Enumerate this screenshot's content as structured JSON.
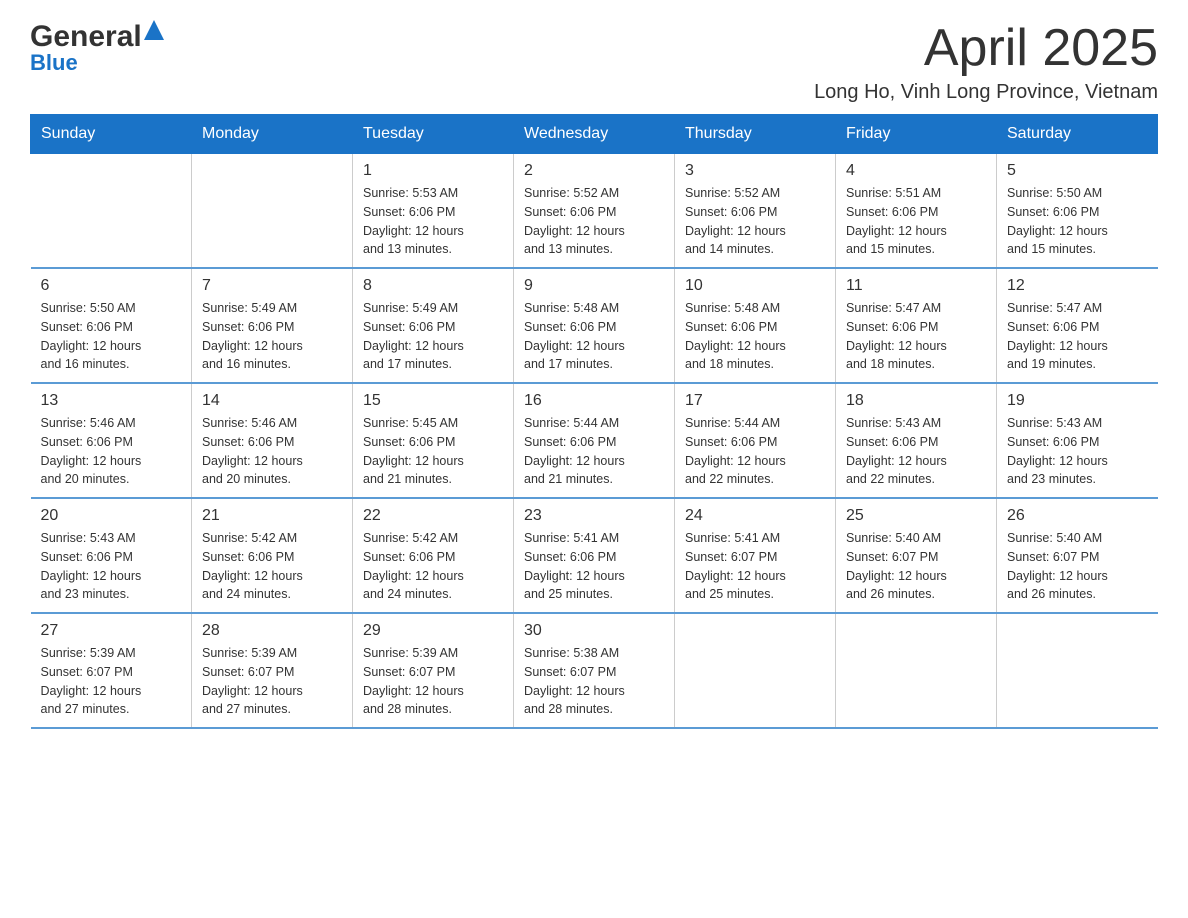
{
  "header": {
    "logo_general": "General",
    "logo_blue": "Blue",
    "title": "April 2025",
    "location": "Long Ho, Vinh Long Province, Vietnam"
  },
  "calendar": {
    "days_of_week": [
      "Sunday",
      "Monday",
      "Tuesday",
      "Wednesday",
      "Thursday",
      "Friday",
      "Saturday"
    ],
    "weeks": [
      [
        {
          "day": "",
          "info": ""
        },
        {
          "day": "",
          "info": ""
        },
        {
          "day": "1",
          "info": "Sunrise: 5:53 AM\nSunset: 6:06 PM\nDaylight: 12 hours\nand 13 minutes."
        },
        {
          "day": "2",
          "info": "Sunrise: 5:52 AM\nSunset: 6:06 PM\nDaylight: 12 hours\nand 13 minutes."
        },
        {
          "day": "3",
          "info": "Sunrise: 5:52 AM\nSunset: 6:06 PM\nDaylight: 12 hours\nand 14 minutes."
        },
        {
          "day": "4",
          "info": "Sunrise: 5:51 AM\nSunset: 6:06 PM\nDaylight: 12 hours\nand 15 minutes."
        },
        {
          "day": "5",
          "info": "Sunrise: 5:50 AM\nSunset: 6:06 PM\nDaylight: 12 hours\nand 15 minutes."
        }
      ],
      [
        {
          "day": "6",
          "info": "Sunrise: 5:50 AM\nSunset: 6:06 PM\nDaylight: 12 hours\nand 16 minutes."
        },
        {
          "day": "7",
          "info": "Sunrise: 5:49 AM\nSunset: 6:06 PM\nDaylight: 12 hours\nand 16 minutes."
        },
        {
          "day": "8",
          "info": "Sunrise: 5:49 AM\nSunset: 6:06 PM\nDaylight: 12 hours\nand 17 minutes."
        },
        {
          "day": "9",
          "info": "Sunrise: 5:48 AM\nSunset: 6:06 PM\nDaylight: 12 hours\nand 17 minutes."
        },
        {
          "day": "10",
          "info": "Sunrise: 5:48 AM\nSunset: 6:06 PM\nDaylight: 12 hours\nand 18 minutes."
        },
        {
          "day": "11",
          "info": "Sunrise: 5:47 AM\nSunset: 6:06 PM\nDaylight: 12 hours\nand 18 minutes."
        },
        {
          "day": "12",
          "info": "Sunrise: 5:47 AM\nSunset: 6:06 PM\nDaylight: 12 hours\nand 19 minutes."
        }
      ],
      [
        {
          "day": "13",
          "info": "Sunrise: 5:46 AM\nSunset: 6:06 PM\nDaylight: 12 hours\nand 20 minutes."
        },
        {
          "day": "14",
          "info": "Sunrise: 5:46 AM\nSunset: 6:06 PM\nDaylight: 12 hours\nand 20 minutes."
        },
        {
          "day": "15",
          "info": "Sunrise: 5:45 AM\nSunset: 6:06 PM\nDaylight: 12 hours\nand 21 minutes."
        },
        {
          "day": "16",
          "info": "Sunrise: 5:44 AM\nSunset: 6:06 PM\nDaylight: 12 hours\nand 21 minutes."
        },
        {
          "day": "17",
          "info": "Sunrise: 5:44 AM\nSunset: 6:06 PM\nDaylight: 12 hours\nand 22 minutes."
        },
        {
          "day": "18",
          "info": "Sunrise: 5:43 AM\nSunset: 6:06 PM\nDaylight: 12 hours\nand 22 minutes."
        },
        {
          "day": "19",
          "info": "Sunrise: 5:43 AM\nSunset: 6:06 PM\nDaylight: 12 hours\nand 23 minutes."
        }
      ],
      [
        {
          "day": "20",
          "info": "Sunrise: 5:43 AM\nSunset: 6:06 PM\nDaylight: 12 hours\nand 23 minutes."
        },
        {
          "day": "21",
          "info": "Sunrise: 5:42 AM\nSunset: 6:06 PM\nDaylight: 12 hours\nand 24 minutes."
        },
        {
          "day": "22",
          "info": "Sunrise: 5:42 AM\nSunset: 6:06 PM\nDaylight: 12 hours\nand 24 minutes."
        },
        {
          "day": "23",
          "info": "Sunrise: 5:41 AM\nSunset: 6:06 PM\nDaylight: 12 hours\nand 25 minutes."
        },
        {
          "day": "24",
          "info": "Sunrise: 5:41 AM\nSunset: 6:07 PM\nDaylight: 12 hours\nand 25 minutes."
        },
        {
          "day": "25",
          "info": "Sunrise: 5:40 AM\nSunset: 6:07 PM\nDaylight: 12 hours\nand 26 minutes."
        },
        {
          "day": "26",
          "info": "Sunrise: 5:40 AM\nSunset: 6:07 PM\nDaylight: 12 hours\nand 26 minutes."
        }
      ],
      [
        {
          "day": "27",
          "info": "Sunrise: 5:39 AM\nSunset: 6:07 PM\nDaylight: 12 hours\nand 27 minutes."
        },
        {
          "day": "28",
          "info": "Sunrise: 5:39 AM\nSunset: 6:07 PM\nDaylight: 12 hours\nand 27 minutes."
        },
        {
          "day": "29",
          "info": "Sunrise: 5:39 AM\nSunset: 6:07 PM\nDaylight: 12 hours\nand 28 minutes."
        },
        {
          "day": "30",
          "info": "Sunrise: 5:38 AM\nSunset: 6:07 PM\nDaylight: 12 hours\nand 28 minutes."
        },
        {
          "day": "",
          "info": ""
        },
        {
          "day": "",
          "info": ""
        },
        {
          "day": "",
          "info": ""
        }
      ]
    ]
  }
}
